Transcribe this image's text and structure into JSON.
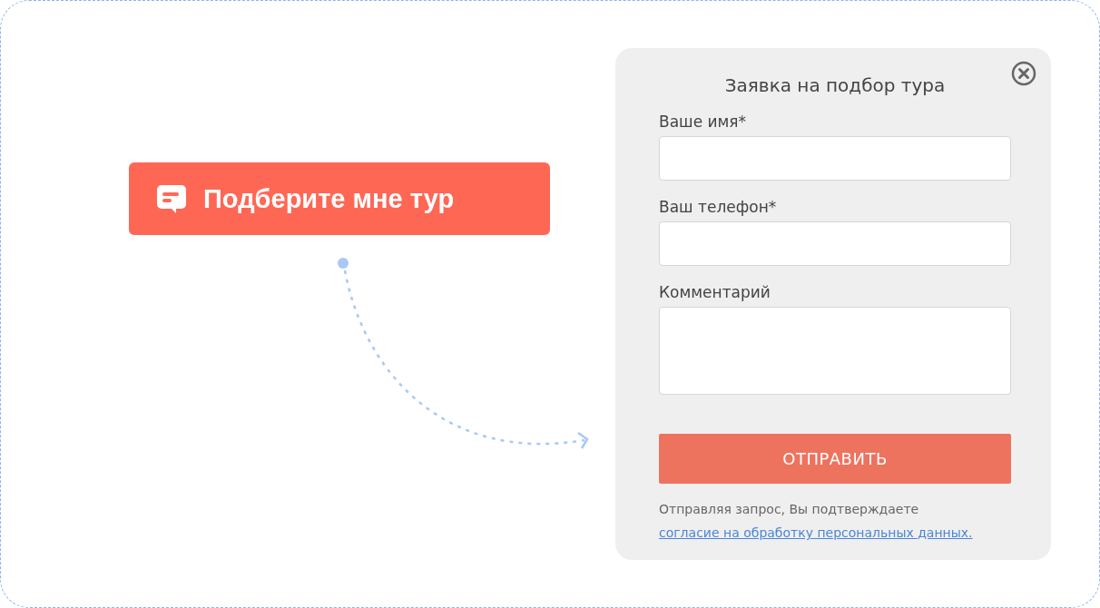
{
  "cta_button": {
    "label": "Подберите мне тур"
  },
  "form": {
    "title": "Заявка на подбор тура",
    "fields": [
      {
        "label": "Ваше имя*",
        "kind": "input"
      },
      {
        "label": "Ваш телефон*",
        "kind": "input"
      },
      {
        "label": "Комментарий",
        "kind": "textarea"
      }
    ],
    "submit": "ОТПРАВИТЬ",
    "consent_text": "Отправляя запрос, Вы подтверждаете",
    "consent_link": "согласие на обработку персональных данных."
  }
}
